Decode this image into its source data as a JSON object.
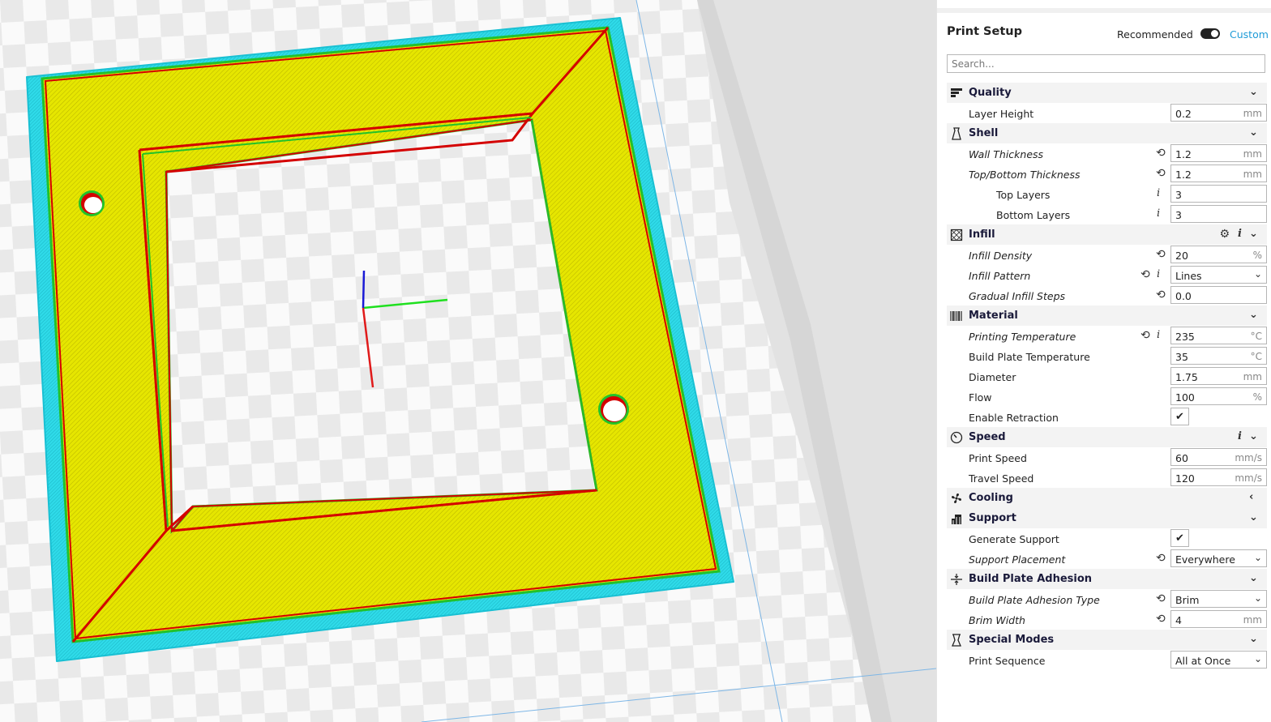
{
  "panel": {
    "title": "Print Setup",
    "mode_recommended": "Recommended",
    "mode_custom": "Custom",
    "search_placeholder": "Search..."
  },
  "colors": {
    "accent": "#1e9bd7",
    "model_fill": "#e6e600",
    "brim": "#29d3e6",
    "wall_inner": "#d40000",
    "wall_outer": "#22c22a"
  },
  "categories": {
    "quality": {
      "label": "Quality",
      "icon": "quality-icon"
    },
    "shell": {
      "label": "Shell",
      "icon": "shell-icon"
    },
    "infill": {
      "label": "Infill",
      "icon": "infill-icon"
    },
    "material": {
      "label": "Material",
      "icon": "material-icon"
    },
    "speed": {
      "label": "Speed",
      "icon": "speed-icon"
    },
    "cooling": {
      "label": "Cooling",
      "icon": "fan-icon"
    },
    "support": {
      "label": "Support",
      "icon": "support-icon"
    },
    "adhesion": {
      "label": "Build Plate Adhesion",
      "icon": "adhesion-icon"
    },
    "special": {
      "label": "Special Modes",
      "icon": "special-modes-icon"
    }
  },
  "settings": {
    "layer_height": {
      "label": "Layer Height",
      "value": "0.2",
      "unit": "mm"
    },
    "wall_thickness": {
      "label": "Wall Thickness",
      "value": "1.2",
      "unit": "mm"
    },
    "topbottom_thickness": {
      "label": "Top/Bottom Thickness",
      "value": "1.2",
      "unit": "mm"
    },
    "top_layers": {
      "label": "Top Layers",
      "value": "3"
    },
    "bottom_layers": {
      "label": "Bottom Layers",
      "value": "3"
    },
    "infill_density": {
      "label": "Infill Density",
      "value": "20",
      "unit": "%"
    },
    "infill_pattern": {
      "label": "Infill Pattern",
      "value": "Lines"
    },
    "gradual_infill": {
      "label": "Gradual Infill Steps",
      "value": "0.0"
    },
    "print_temp": {
      "label": "Printing Temperature",
      "value": "235",
      "unit": "°C"
    },
    "plate_temp": {
      "label": "Build Plate Temperature",
      "value": "35",
      "unit": "°C"
    },
    "diameter": {
      "label": "Diameter",
      "value": "1.75",
      "unit": "mm"
    },
    "flow": {
      "label": "Flow",
      "value": "100",
      "unit": "%"
    },
    "retraction": {
      "label": "Enable Retraction",
      "checked": true
    },
    "print_speed": {
      "label": "Print Speed",
      "value": "60",
      "unit": "mm/s"
    },
    "travel_speed": {
      "label": "Travel Speed",
      "value": "120",
      "unit": "mm/s"
    },
    "generate_support": {
      "label": "Generate Support",
      "checked": true
    },
    "support_placement": {
      "label": "Support Placement",
      "value": "Everywhere"
    },
    "adhesion_type": {
      "label": "Build Plate Adhesion Type",
      "value": "Brim"
    },
    "brim_width": {
      "label": "Brim Width",
      "value": "4",
      "unit": "mm"
    },
    "print_sequence": {
      "label": "Print Sequence",
      "value": "All at Once"
    }
  }
}
